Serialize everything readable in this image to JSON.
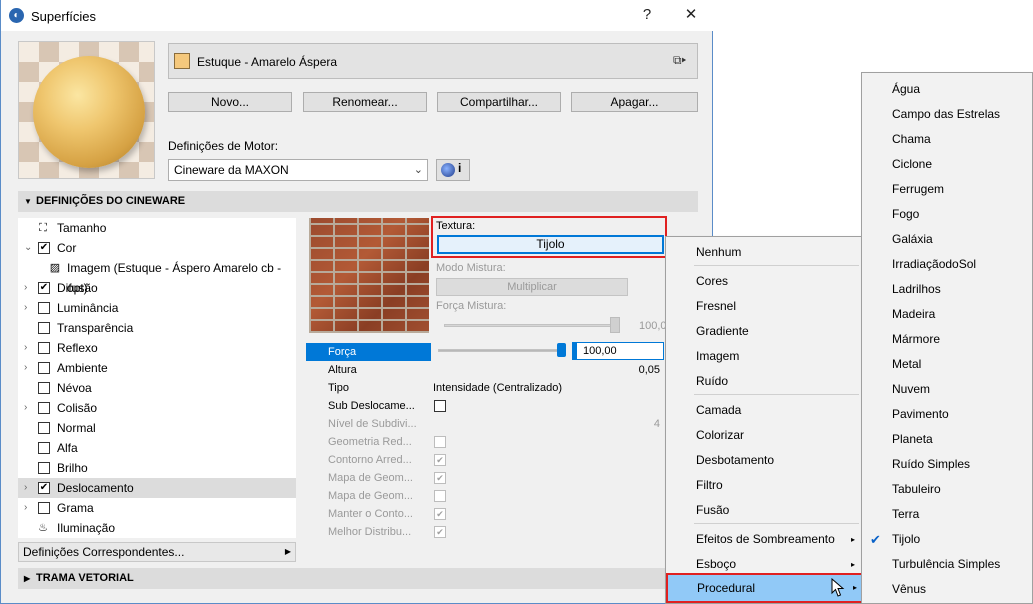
{
  "window": {
    "title": "Superfícies",
    "help_label": "?",
    "close_label": "✕"
  },
  "surface": {
    "name": "Estuque - Amarelo Áspera",
    "swatch_color": "#f5c87c"
  },
  "buttons": {
    "new": "Novo...",
    "rename": "Renomear...",
    "share": "Compartilhar...",
    "delete": "Apagar..."
  },
  "motor": {
    "label": "Definições de Motor:",
    "value": "Cineware da MAXON",
    "info": "i"
  },
  "sections": {
    "cineware": "DEFINIÇÕES DO CINEWARE",
    "trama": "TRAMA VETORIAL",
    "correspondentes": "Definições Correspondentes..."
  },
  "channels": [
    {
      "label": "Tamanho",
      "icon": "size-icon"
    },
    {
      "label": "Cor",
      "checked": true,
      "expanded": true
    },
    {
      "label": "Imagem (Estuque - Áspero Amarelo cb -opt)",
      "icon": "image-icon"
    },
    {
      "label": "Difusão",
      "checked": true
    },
    {
      "label": "Luminância",
      "checked": false
    },
    {
      "label": "Transparência",
      "checked": false
    },
    {
      "label": "Reflexo",
      "checked": false
    },
    {
      "label": "Ambiente",
      "checked": false
    },
    {
      "label": "Névoa",
      "checked": false
    },
    {
      "label": "Colisão",
      "checked": false
    },
    {
      "label": "Normal",
      "checked": false
    },
    {
      "label": "Alfa",
      "checked": false
    },
    {
      "label": "Brilho",
      "checked": false
    },
    {
      "label": "Deslocamento",
      "checked": true,
      "selected": true
    },
    {
      "label": "Grama",
      "checked": false
    },
    {
      "label": "Iluminação",
      "icon": "lightbulb-icon"
    }
  ],
  "texture": {
    "label": "Textura:",
    "value": "Tijolo",
    "mix_mode_label": "Modo Mistura:",
    "mix_mode_value": "Multiplicar",
    "mix_force_label": "Força Mistura:",
    "mix_force_value": "100,0"
  },
  "properties": [
    {
      "label": "Força",
      "value": "100,00"
    },
    {
      "label": "Altura",
      "value": "0,05"
    },
    {
      "label": "Tipo",
      "value": "Intensidade (Centralizado)"
    },
    {
      "label": "Sub Deslocame..."
    },
    {
      "label": "Nível de Subdivi...",
      "value": "4"
    },
    {
      "label": "Geometria Red..."
    },
    {
      "label": "Contorno Arred..."
    },
    {
      "label": "Mapa de Geom..."
    },
    {
      "label": "Mapa de Geom..."
    },
    {
      "label": "Manter o Conto..."
    },
    {
      "label": "Melhor Distribu..."
    }
  ],
  "menu1": {
    "items": [
      "Nenhum",
      "Cores",
      "Fresnel",
      "Gradiente",
      "Imagem",
      "Ruído",
      "Camada",
      "Colorizar",
      "Desbotamento",
      "Filtro",
      "Fusão",
      "Efeitos de Sombreamento",
      "Esboço",
      "Procedural"
    ],
    "submenu_arrow": "▸"
  },
  "menu2": {
    "items": [
      "Água",
      "Campo das Estrelas",
      "Chama",
      "Ciclone",
      "Ferrugem",
      "Fogo",
      "Galáxia",
      "IrradiaçãodoSol",
      "Ladrilhos",
      "Madeira",
      "Mármore",
      "Metal",
      "Nuvem",
      "Pavimento",
      "Planeta",
      "Ruído Simples",
      "Tabuleiro",
      "Terra",
      "Tijolo",
      "Turbulência Simples",
      "Vênus"
    ],
    "checked_item": "Tijolo",
    "check_mark": "✔"
  },
  "colors": {
    "accent": "#0078d7",
    "highlight_border": "#e02020",
    "menu_hover": "#91c9f7"
  }
}
